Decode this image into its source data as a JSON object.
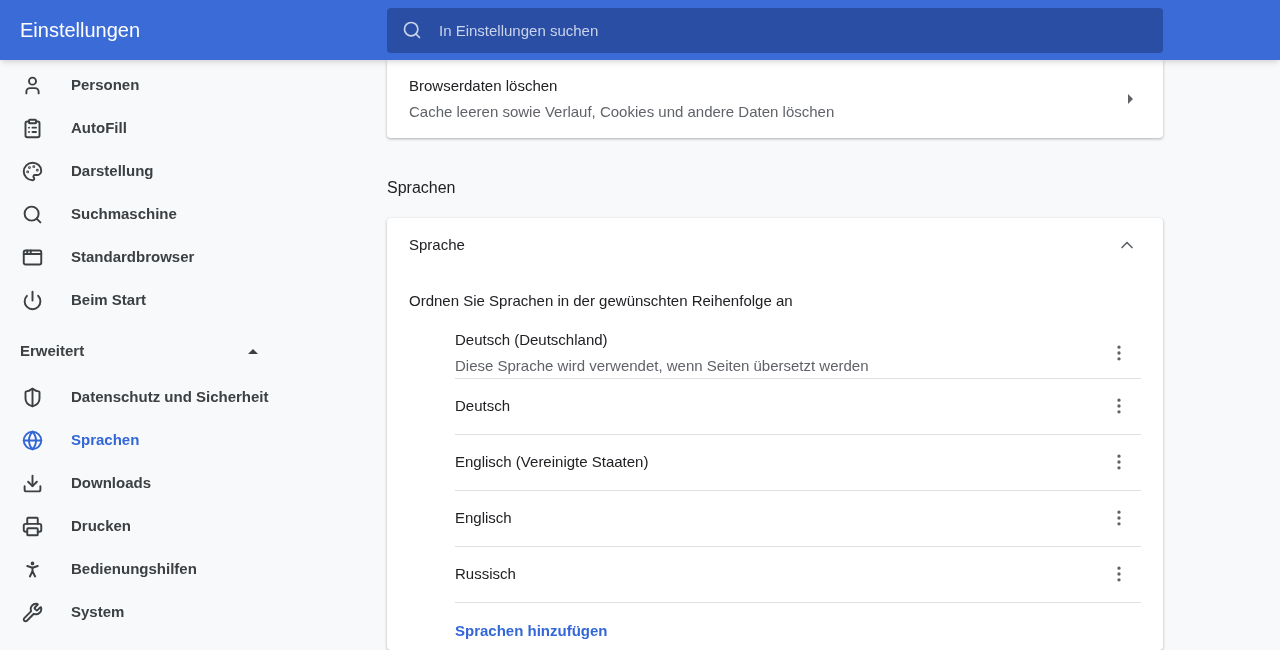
{
  "header": {
    "title": "Einstellungen",
    "search": {
      "placeholder": "In Einstellungen suchen"
    }
  },
  "sidebar": {
    "items": [
      {
        "label": "Personen",
        "selected": false
      },
      {
        "label": "AutoFill",
        "selected": false
      },
      {
        "label": "Darstellung",
        "selected": false
      },
      {
        "label": "Suchmaschine",
        "selected": false
      },
      {
        "label": "Standardbrowser",
        "selected": false
      },
      {
        "label": "Beim Start",
        "selected": false
      }
    ],
    "advanced": {
      "label": "Erweitert",
      "expanded": true,
      "items": [
        {
          "label": "Datenschutz und Sicherheit",
          "selected": false
        },
        {
          "label": "Sprachen",
          "selected": true
        },
        {
          "label": "Downloads",
          "selected": false
        },
        {
          "label": "Drucken",
          "selected": false
        },
        {
          "label": "Bedienungshilfen",
          "selected": false
        },
        {
          "label": "System",
          "selected": false
        }
      ]
    }
  },
  "clear_data": {
    "title": "Browserdaten löschen",
    "subtitle": "Cache leeren sowie Verlauf, Cookies und andere Daten löschen"
  },
  "languages_section": {
    "heading": "Sprachen",
    "card": {
      "title": "Sprache",
      "expanded": true,
      "instruction": "Ordnen Sie Sprachen in der gewünschten Reihenfolge an",
      "languages": [
        {
          "name": "Deutsch (Deutschland)",
          "note": "Diese Sprache wird verwendet, wenn Seiten übersetzt werden"
        },
        {
          "name": "Deutsch"
        },
        {
          "name": "Englisch (Vereinigte Staaten)"
        },
        {
          "name": "Englisch"
        },
        {
          "name": "Russisch"
        }
      ],
      "add_link": "Sprachen hinzufügen"
    }
  }
}
